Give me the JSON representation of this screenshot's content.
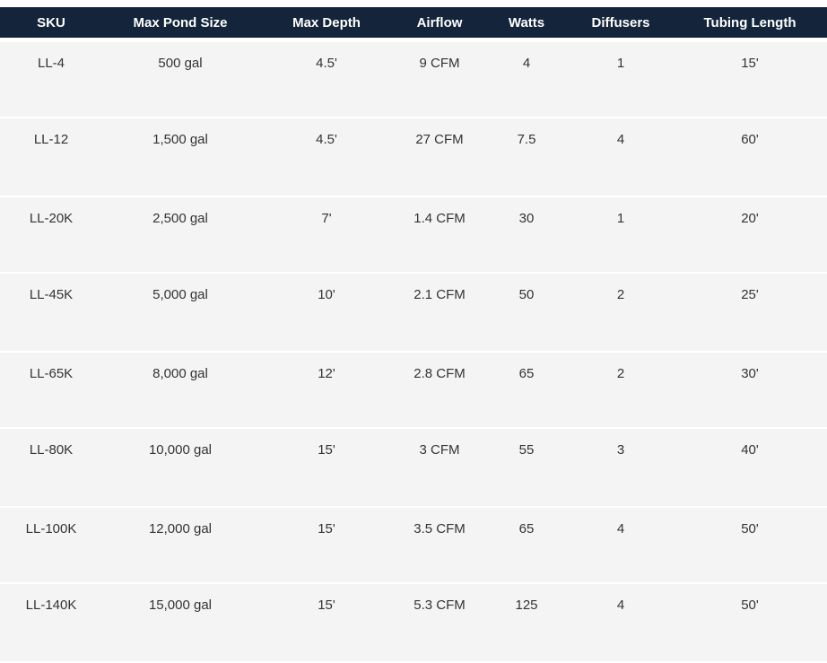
{
  "table": {
    "columns": [
      "SKU",
      "Max Pond Size",
      "Max Depth",
      "Airflow",
      "Watts",
      "Diffusers",
      "Tubing Length"
    ],
    "rows": [
      [
        "LL-4",
        "500 gal",
        "4.5'",
        "9 CFM",
        "4",
        "1",
        "15'"
      ],
      [
        "LL-12",
        "1,500 gal",
        "4.5'",
        "27 CFM",
        "7.5",
        "4",
        "60'"
      ],
      [
        "LL-20K",
        "2,500 gal",
        "7'",
        "1.4 CFM",
        "30",
        "1",
        "20'"
      ],
      [
        "LL-45K",
        "5,000 gal",
        "10'",
        "2.1 CFM",
        "50",
        "2",
        "25'"
      ],
      [
        "LL-65K",
        "8,000 gal",
        "12'",
        "2.8 CFM",
        "65",
        "2",
        "30'"
      ],
      [
        "LL-80K",
        "10,000 gal",
        "15'",
        "3 CFM",
        "55",
        "3",
        "40'"
      ],
      [
        "LL-100K",
        "12,000 gal",
        "15'",
        "3.5 CFM",
        "65",
        "4",
        "50'"
      ],
      [
        "LL-140K",
        "15,000 gal",
        "15'",
        "5.3 CFM",
        "125",
        "4",
        "50'"
      ]
    ]
  },
  "colors": {
    "header_bg": "#13243b",
    "header_text": "#ffffff",
    "row_bg": "#f4f4f4",
    "cell_text": "#333333"
  }
}
